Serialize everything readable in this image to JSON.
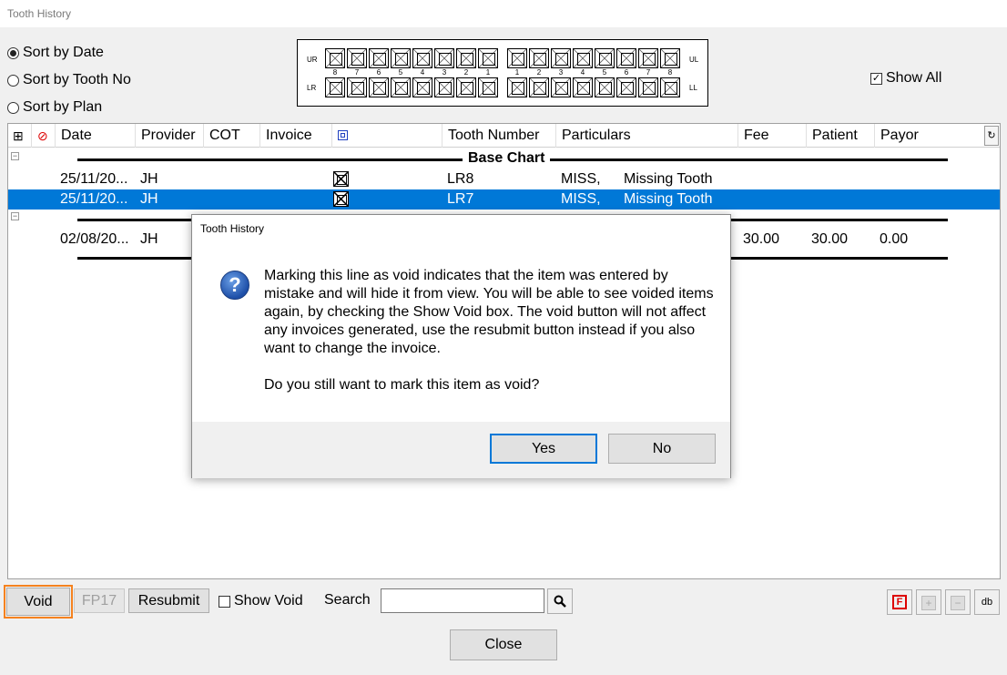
{
  "window": {
    "title": "Tooth History"
  },
  "sort_options": [
    {
      "label": "Sort by Date",
      "selected": true
    },
    {
      "label": "Sort by Tooth No",
      "selected": false
    },
    {
      "label": "Sort by Plan",
      "selected": false
    }
  ],
  "tooth_chart": {
    "quadrants": {
      "ur": "UR",
      "ul": "UL",
      "lr": "LR",
      "ll": "LL"
    },
    "right_numbers": [
      "8",
      "7",
      "6",
      "5",
      "4",
      "3",
      "2",
      "1"
    ],
    "left_numbers": [
      "1",
      "2",
      "3",
      "4",
      "5",
      "6",
      "7",
      "8"
    ]
  },
  "show_all": {
    "label": "Show All",
    "checked": true
  },
  "grid": {
    "headers": {
      "expand": "⊞",
      "void": "⊘",
      "date": "Date",
      "provider": "Provider",
      "cot": "COT",
      "invoice": "Invoice",
      "tooth_number": "Tooth Number",
      "particulars": "Particulars",
      "fee": "Fee",
      "patient": "Patient",
      "payor": "Payor"
    },
    "group1": {
      "title": "Base Chart"
    },
    "rows": [
      {
        "date": "25/11/20...",
        "provider": "JH",
        "tooth": "LR8",
        "code": "MISS,",
        "desc": "Missing Tooth",
        "selected": false
      },
      {
        "date": "25/11/20...",
        "provider": "JH",
        "tooth": "LR7",
        "code": "MISS,",
        "desc": "Missing Tooth",
        "selected": true
      },
      {
        "date": "02/08/20...",
        "provider": "JH",
        "fee": "30.00",
        "patient": "30.00",
        "payor": "0.00"
      }
    ]
  },
  "dialog": {
    "title": "Tooth History",
    "message": "Marking this line as void indicates that the item was entered by mistake and will hide it from view. You will be able to see voided items again, by checking the Show Void box. The void button will not affect any invoices generated, use the resubmit button instead if you also want to change the invoice.",
    "question": "Do you still want to mark this item as void?",
    "yes_label": "Yes",
    "no_label": "No"
  },
  "toolbar": {
    "void_label": "Void",
    "fp17_label": "FP17",
    "resubmit_label": "Resubmit",
    "show_void_label": "Show Void",
    "search_label": "Search",
    "search_value": "",
    "db_label": "db"
  },
  "close_label": "Close",
  "colors": {
    "selection": "#0078d7",
    "focus": "#f5821f"
  }
}
